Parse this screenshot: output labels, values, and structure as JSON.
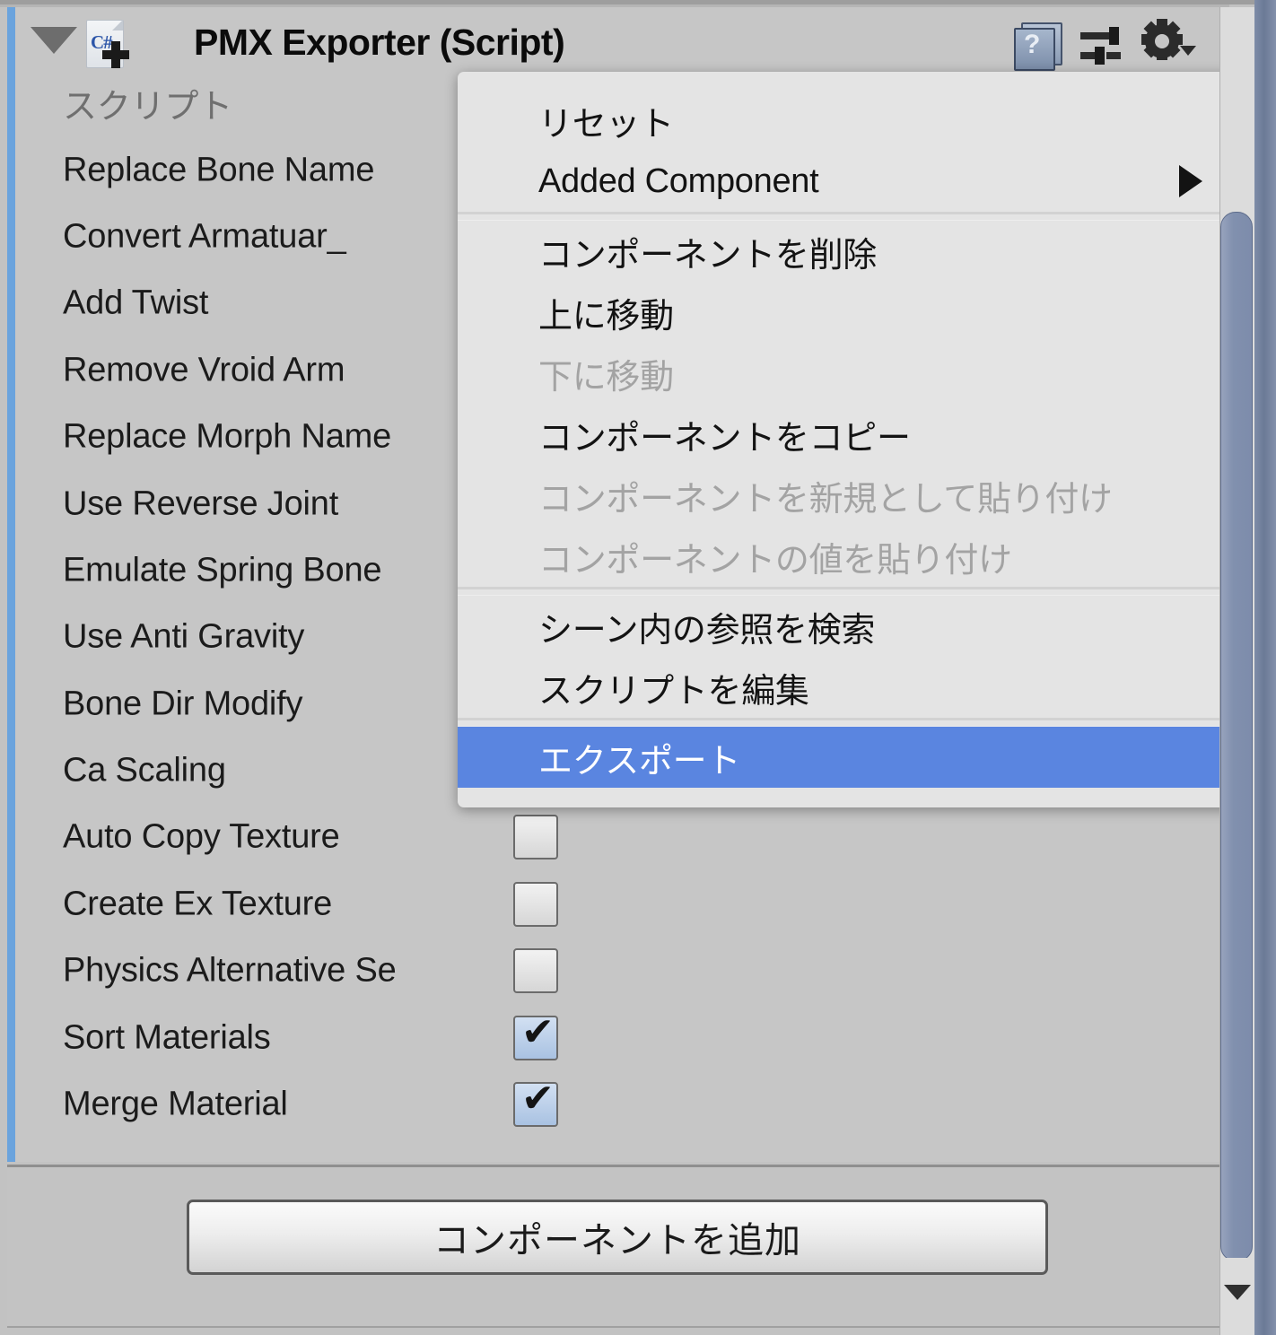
{
  "component": {
    "title": "PMX Exporter (Script)",
    "foldout_expanded": true,
    "script_icon": "cs-script-icon",
    "header_icons": [
      {
        "name": "help-icon",
        "glyph": "?"
      },
      {
        "name": "preset-icon",
        "glyph": "sliders"
      },
      {
        "name": "gear-icon",
        "glyph": "gear"
      }
    ],
    "accent_prefab_color": "#6aa3dd"
  },
  "properties": [
    {
      "label": "スクリプト",
      "type": "object",
      "dim": true,
      "value": ""
    },
    {
      "label": "Replace Bone Name",
      "type": "checkbox",
      "checked": false
    },
    {
      "label": "Convert Armatuar_",
      "type": "checkbox",
      "checked": false
    },
    {
      "label": "Add Twist",
      "type": "checkbox",
      "checked": false
    },
    {
      "label": "Remove Vroid Arm",
      "type": "checkbox",
      "checked": false
    },
    {
      "label": "Replace Morph Name",
      "type": "checkbox",
      "checked": false
    },
    {
      "label": "Use Reverse Joint",
      "type": "checkbox",
      "checked": false
    },
    {
      "label": "Emulate Spring Bone",
      "type": "checkbox",
      "checked": false
    },
    {
      "label": "Use Anti Gravity",
      "type": "checkbox",
      "checked": false
    },
    {
      "label": "Bone Dir Modify",
      "type": "checkbox",
      "checked": false
    },
    {
      "label": "Ca Scaling",
      "type": "checkbox",
      "checked": false
    },
    {
      "label": "Auto Copy Texture",
      "type": "checkbox",
      "checked": false
    },
    {
      "label": "Create Ex Texture",
      "type": "checkbox",
      "checked": false
    },
    {
      "label": "Physics Alternative Se",
      "type": "checkbox",
      "checked": false
    },
    {
      "label": "Sort Materials",
      "type": "checkbox",
      "checked": true
    },
    {
      "label": "Merge Material",
      "type": "checkbox",
      "checked": true
    }
  ],
  "add_component": {
    "label": "コンポーネントを追加"
  },
  "context_menu": {
    "highlight_color": "#5a85e0",
    "groups": [
      {
        "items": [
          {
            "label": "リセット",
            "disabled": false,
            "submenu": false,
            "selected": false
          },
          {
            "label": "Added Component",
            "disabled": false,
            "submenu": true,
            "selected": false
          }
        ]
      },
      {
        "items": [
          {
            "label": "コンポーネントを削除",
            "disabled": false,
            "submenu": false,
            "selected": false
          },
          {
            "label": "上に移動",
            "disabled": false,
            "submenu": false,
            "selected": false
          },
          {
            "label": "下に移動",
            "disabled": true,
            "submenu": false,
            "selected": false
          },
          {
            "label": "コンポーネントをコピー",
            "disabled": false,
            "submenu": false,
            "selected": false
          },
          {
            "label": "コンポーネントを新規として貼り付け",
            "disabled": true,
            "submenu": false,
            "selected": false
          },
          {
            "label": "コンポーネントの値を貼り付け",
            "disabled": true,
            "submenu": false,
            "selected": false
          }
        ]
      },
      {
        "items": [
          {
            "label": "シーン内の参照を検索",
            "disabled": false,
            "submenu": false,
            "selected": false
          },
          {
            "label": "スクリプトを編集",
            "disabled": false,
            "submenu": false,
            "selected": false
          }
        ]
      },
      {
        "items": [
          {
            "label": "エクスポート",
            "disabled": false,
            "submenu": false,
            "selected": true
          }
        ]
      }
    ]
  },
  "scrollbar": {
    "orientation": "vertical",
    "down_arrow": "chevron-down-icon"
  }
}
